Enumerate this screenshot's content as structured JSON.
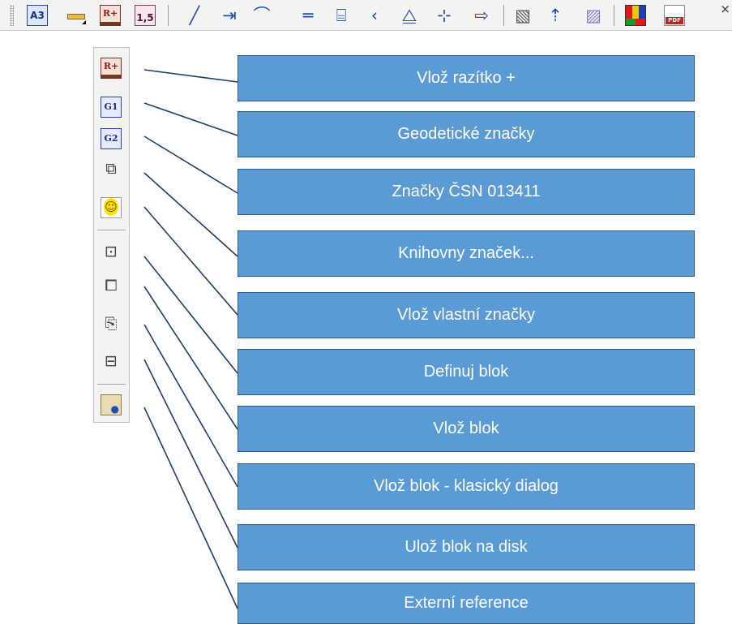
{
  "toolbar": {
    "a3_label": "A3",
    "r_label": "R+",
    "scale_label": "1,5",
    "close_glyph": "×",
    "icons": [
      "a3-format-icon",
      "ruler-icon",
      "stamp-plus-icon",
      "scale-icon",
      "line-icon",
      "dimension-icon",
      "arc-icon",
      "parallel-icon",
      "polyline-icon",
      "angle-icon",
      "mirror-icon",
      "coordinates-icon",
      "insert-icon",
      "hatch-icon",
      "block-upload-icon",
      "pattern-icon",
      "color-table-icon",
      "pdf-export-icon"
    ]
  },
  "dropdown": {
    "r_label": "R+",
    "g1_label": "G1",
    "g2_label": "G2"
  },
  "callouts": [
    {
      "label": "Vlož razítko +"
    },
    {
      "label": "Geodetické značky"
    },
    {
      "label": "Značky ČSN 013411"
    },
    {
      "label": "Knihovny značek..."
    },
    {
      "label": "Vlož vlastní značky"
    },
    {
      "label": "Definuj blok"
    },
    {
      "label": "Vlož blok"
    },
    {
      "label": "Vlož blok - klasický dialog"
    },
    {
      "label": "Ulož blok na disk"
    },
    {
      "label": "Externí reference"
    }
  ],
  "colors": {
    "callout_fill": "#5b9bd5",
    "callout_border": "#2e5c8a",
    "leader_line": "#1f3d6b"
  }
}
